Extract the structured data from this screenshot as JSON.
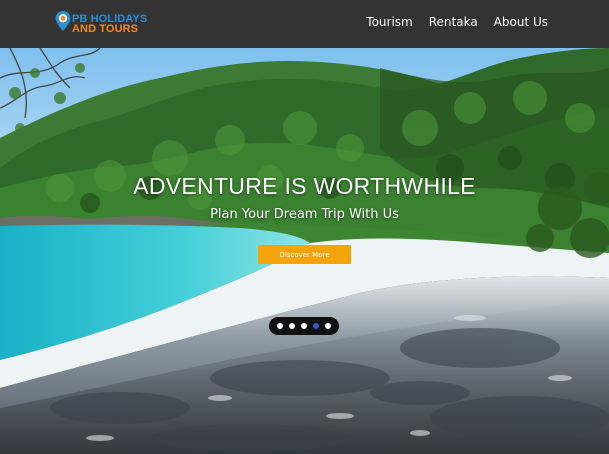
{
  "brand": {
    "line1": "PB HOLIDAYS",
    "line2": "AND TOURS",
    "colors": {
      "blue": "#2a8fd6",
      "orange": "#f08a24"
    }
  },
  "nav": {
    "items": [
      {
        "label": "Tourism"
      },
      {
        "label": "Rentaka"
      },
      {
        "label": "About Us"
      }
    ]
  },
  "hero": {
    "title": "ADVENTURE IS WORTHWHILE",
    "subtitle": "Plan Your Dream Trip With Us",
    "cta_label": "Discover More",
    "cta_color": "#f5a30a",
    "slides": {
      "count": 5,
      "active_index": 3
    }
  },
  "colors": {
    "header_bg": "#333333",
    "active_dot": "#3a56d8"
  }
}
